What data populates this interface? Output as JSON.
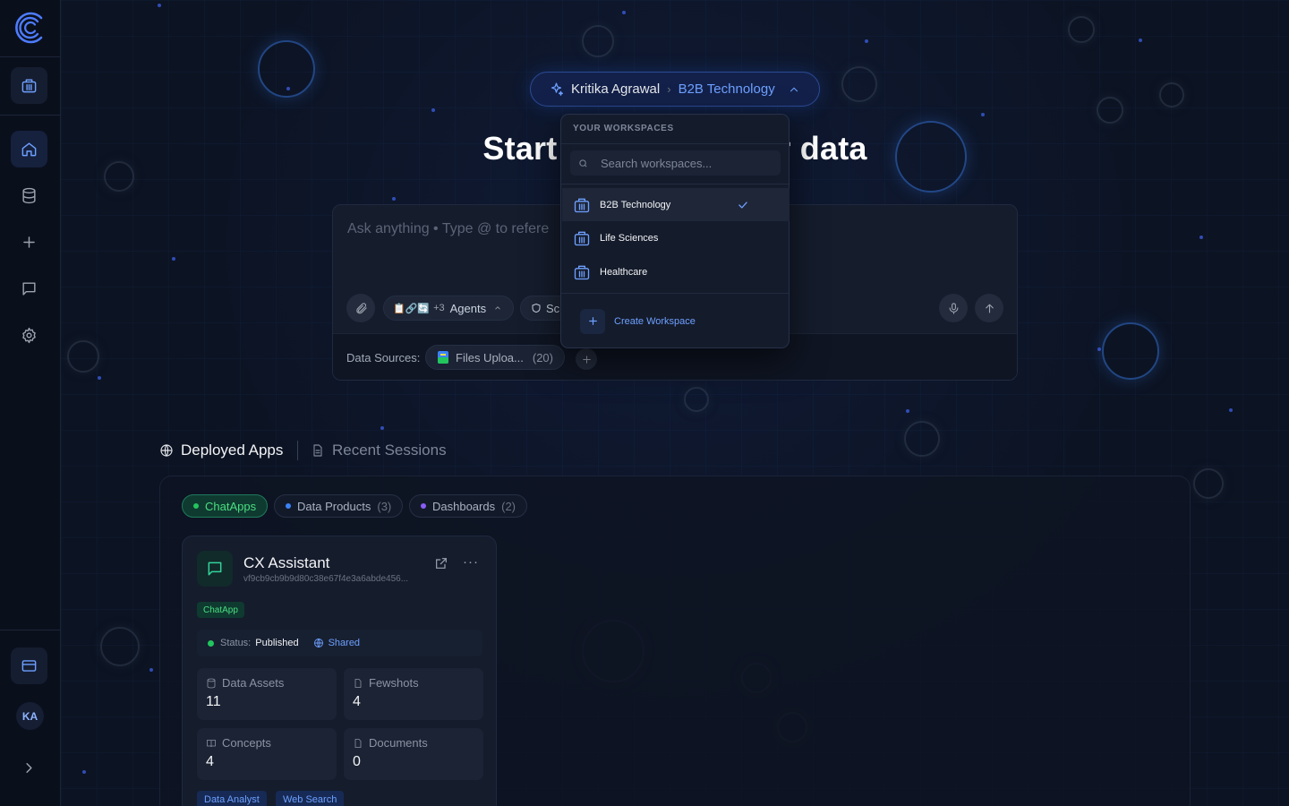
{
  "workspace_selector": {
    "user_name": "Kritika Agrawal",
    "workspace_name": "B2B Technology"
  },
  "hero": {
    "title_start": "Start",
    "title_end": "r data"
  },
  "chat": {
    "placeholder": "Ask anything • Type @ to refere",
    "agents_icons": "📋🔗🔄",
    "agents_extra": "+3",
    "agents_label": "Agents",
    "scope_label": "Sc",
    "data_sources_label": "Data Sources:",
    "source_label": "Files Uploa...",
    "source_count": "(20)"
  },
  "tabs": {
    "deployed": "Deployed Apps",
    "recent": "Recent Sessions"
  },
  "filters": [
    {
      "label": "ChatApps",
      "count": "",
      "color": "#22c55e"
    },
    {
      "label": "Data Products",
      "count": "(3)",
      "color": "#3b82f6"
    },
    {
      "label": "Dashboards",
      "count": "(2)",
      "color": "#8b5cf6"
    }
  ],
  "app_card": {
    "name": "CX Assistant",
    "id": "vf9cb9cb9b9d80c38e67f4e3a6abde456...",
    "type_tag": "ChatApp",
    "status_label": "Status:",
    "status_value": "Published",
    "shared_label": "Shared",
    "stats": [
      {
        "label": "Data Assets",
        "value": "11"
      },
      {
        "label": "Fewshots",
        "value": "4"
      },
      {
        "label": "Concepts",
        "value": "4"
      },
      {
        "label": "Documents",
        "value": "0"
      }
    ],
    "tags": [
      "Data Analyst",
      "Web Search"
    ]
  },
  "dropdown": {
    "heading": "YOUR WORKSPACES",
    "search_placeholder": "Search workspaces...",
    "items": [
      {
        "label": "B2B Technology",
        "selected": true
      },
      {
        "label": "Life Sciences",
        "selected": false
      },
      {
        "label": "Healthcare",
        "selected": false
      }
    ],
    "create_label": "Create Workspace"
  },
  "sidebar": {
    "avatar_initials": "KA"
  },
  "colors": {
    "accent": "#6ea0ff",
    "background": "#0b1120",
    "success": "#22c55e"
  }
}
